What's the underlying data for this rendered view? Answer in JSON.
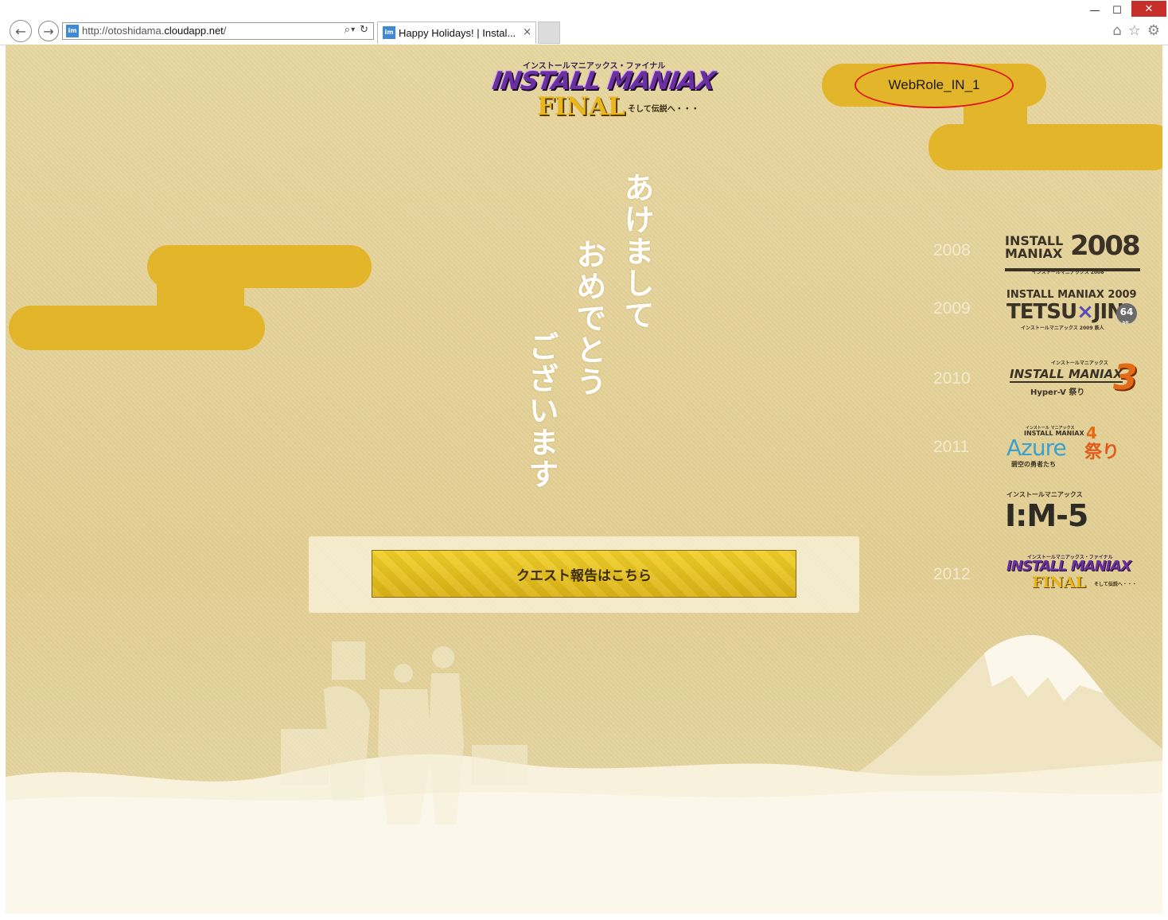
{
  "browser": {
    "url_prefix": "http://otoshidama.",
    "url_domain": "cloudapp.net",
    "url_suffix": "/",
    "tab_title": "Happy Holidays! | Instal...",
    "tab_close": "×",
    "favicon_text": "im",
    "win_minimize": "—",
    "win_maximize": "☐",
    "win_close": "✕",
    "back_glyph": "←",
    "forward_glyph": "→",
    "search_glyph": "⌕",
    "dropdown_glyph": "▾",
    "refresh_glyph": "↻",
    "home_glyph": "⌂",
    "star_glyph": "☆",
    "gear_glyph": "⚙"
  },
  "header": {
    "logo_kana": "インストールマニアックス・ファイナル",
    "logo_main": "INSTALL MANIAX",
    "logo_final": "FINAL",
    "logo_sub": "そして伝説へ・・・",
    "role_label": "WebRole_IN_1"
  },
  "greeting": {
    "col1": "あけまして",
    "col2": "おめでとう",
    "col3": "ございます"
  },
  "cta": {
    "label": "クエスト報告はこちら"
  },
  "history": [
    {
      "year": "2008",
      "line1": "INSTALL",
      "line2": "MANIAX",
      "big": "2008",
      "sub": "インストールマニアックス 2008"
    },
    {
      "year": "2009",
      "line1": "INSTALL MANIAX 2009",
      "line2": "TETSU",
      "cross": "×",
      "line3": "JIN",
      "badge": "64",
      "badge_sub": "bit",
      "sub": "インストールマニアックス 2009 鉄人"
    },
    {
      "year": "2010",
      "kana": "インストールマニアックス",
      "line1": "INSTALL MANIAX",
      "big": "3",
      "sub": "Hyper-V 祭り"
    },
    {
      "year": "2011",
      "kana": "インストール マニアックス",
      "line1": "INSTALL MANIAX",
      "big": "4",
      "line2": "Azure",
      "fest": "祭り",
      "sub": "碧空の勇者たち"
    },
    {
      "year": "",
      "kana": "インストールマニアックス",
      "line1": "I:M-5"
    },
    {
      "year": "2012",
      "kana": "インストールマニアックス・ファイナル",
      "line1": "INSTALL MANIAX",
      "line2": "FINAL",
      "sub": "そして伝説へ・・・"
    }
  ],
  "colors": {
    "page_bg": "#e5d39b",
    "cloud": "#e3b52a",
    "cta": "#e6c01f",
    "highlight": "#e0161a"
  }
}
